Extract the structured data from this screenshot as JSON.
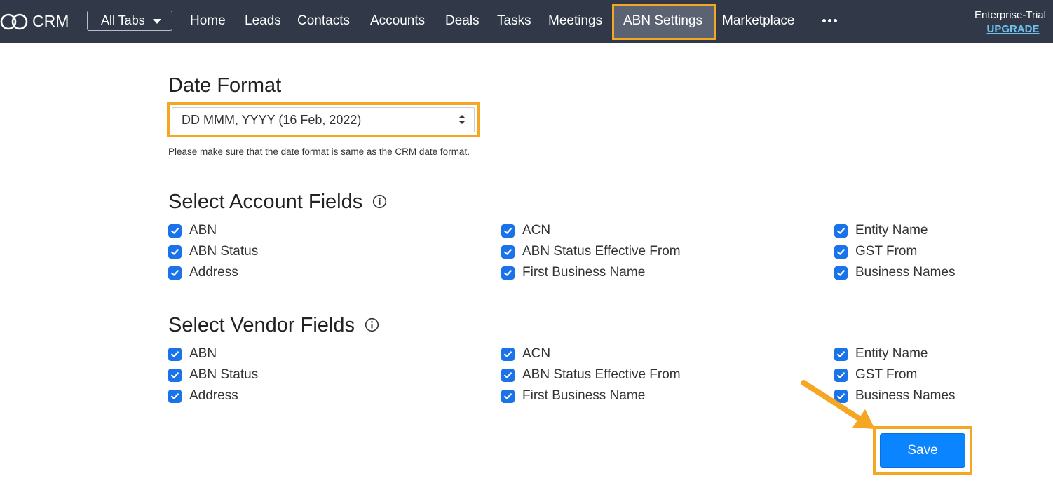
{
  "header": {
    "brand": "CRM",
    "all_tabs_label": "All Tabs",
    "nav_items": [
      "Home",
      "Leads",
      "Contacts",
      "Accounts",
      "Deals",
      "Tasks",
      "Meetings",
      "ABN Settings",
      "Marketplace"
    ],
    "active_item": "ABN Settings",
    "plan_label": "Enterprise-Trial",
    "upgrade_label": "UPGRADE"
  },
  "date_format": {
    "heading": "Date Format",
    "selected_value": "DD MMM, YYYY (16 Feb, 2022)",
    "hint": "Please make sure that the date format is same as the CRM date format."
  },
  "account_fields": {
    "heading": "Select Account Fields",
    "items": [
      {
        "label": "ABN",
        "checked": true
      },
      {
        "label": "ABN Status",
        "checked": true
      },
      {
        "label": "Address",
        "checked": true
      },
      {
        "label": "ACN",
        "checked": true
      },
      {
        "label": "ABN Status Effective From",
        "checked": true
      },
      {
        "label": "First Business Name",
        "checked": true
      },
      {
        "label": "Entity Name",
        "checked": true
      },
      {
        "label": "GST From",
        "checked": true
      },
      {
        "label": "Business Names",
        "checked": true
      }
    ]
  },
  "vendor_fields": {
    "heading": "Select Vendor Fields",
    "items": [
      {
        "label": "ABN",
        "checked": true
      },
      {
        "label": "ABN Status",
        "checked": true
      },
      {
        "label": "Address",
        "checked": true
      },
      {
        "label": "ACN",
        "checked": true
      },
      {
        "label": "ABN Status Effective From",
        "checked": true
      },
      {
        "label": "First Business Name",
        "checked": true
      },
      {
        "label": "Entity Name",
        "checked": true
      },
      {
        "label": "GST From",
        "checked": true
      },
      {
        "label": "Business Names",
        "checked": true
      }
    ]
  },
  "save_label": "Save",
  "colors": {
    "topbar": "#313949",
    "highlight": "#f5a623",
    "checkbox": "#1a73e8",
    "save_button": "#0a84ff",
    "upgrade_link": "#6ec1ef"
  },
  "icons": [
    "crm-logo-icon",
    "chevron-down-icon",
    "more-horizontal-icon",
    "info-icon",
    "checkmark-icon",
    "sort-arrows-icon",
    "callout-arrow-icon"
  ]
}
